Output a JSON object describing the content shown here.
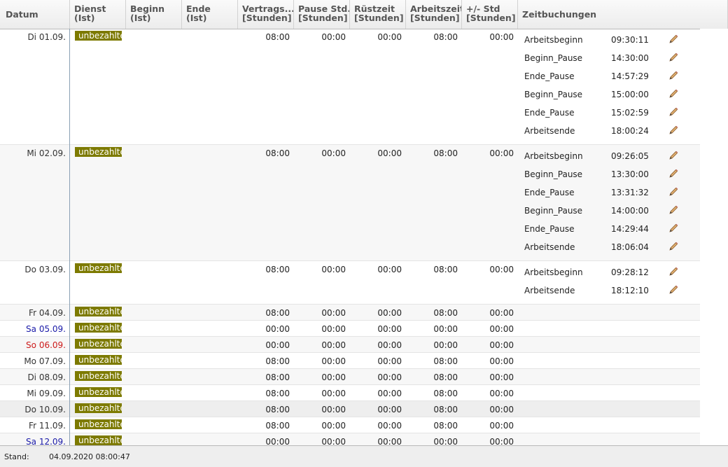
{
  "columns": [
    {
      "l1": "Datum",
      "l2": ""
    },
    {
      "l1": "Dienst",
      "l2": "(Ist)"
    },
    {
      "l1": "Beginn",
      "l2": "(Ist)"
    },
    {
      "l1": "Ende",
      "l2": "(Ist)"
    },
    {
      "l1": "Vertrags...",
      "l2": "[Stunden]"
    },
    {
      "l1": "Pause Std.",
      "l2": "[Stunden]"
    },
    {
      "l1": "Rüstzeit",
      "l2": "[Stunden]"
    },
    {
      "l1": "Arbeitszeit",
      "l2": "[Stunden]"
    },
    {
      "l1": "+/- Std",
      "l2": "[Stunden]"
    },
    {
      "l1": "Zeitbuchungen",
      "l2": ""
    }
  ],
  "rows": [
    {
      "date": "Di 01.09.",
      "day": "weekday",
      "service": "unbezahlte",
      "vertrag": "08:00",
      "pause": "00:00",
      "ruest": "00:00",
      "arbeit": "08:00",
      "diff": "00:00",
      "bookings": [
        {
          "label": "Arbeitsbeginn",
          "time": "09:30:11"
        },
        {
          "label": "Beginn_Pause",
          "time": "14:30:00"
        },
        {
          "label": "Ende_Pause",
          "time": "14:57:29"
        },
        {
          "label": "Beginn_Pause",
          "time": "15:00:00"
        },
        {
          "label": "Ende_Pause",
          "time": "15:02:59"
        },
        {
          "label": "Arbeitsende",
          "time": "18:00:24"
        }
      ]
    },
    {
      "date": "Mi 02.09.",
      "day": "weekday",
      "service": "unbezahlte",
      "vertrag": "08:00",
      "pause": "00:00",
      "ruest": "00:00",
      "arbeit": "08:00",
      "diff": "00:00",
      "bookings": [
        {
          "label": "Arbeitsbeginn",
          "time": "09:26:05"
        },
        {
          "label": "Beginn_Pause",
          "time": "13:30:00"
        },
        {
          "label": "Ende_Pause",
          "time": "13:31:32"
        },
        {
          "label": "Beginn_Pause",
          "time": "14:00:00"
        },
        {
          "label": "Ende_Pause",
          "time": "14:29:44"
        },
        {
          "label": "Arbeitsende",
          "time": "18:06:04"
        }
      ]
    },
    {
      "date": "Do 03.09.",
      "day": "weekday",
      "service": "unbezahlte",
      "vertrag": "08:00",
      "pause": "00:00",
      "ruest": "00:00",
      "arbeit": "08:00",
      "diff": "00:00",
      "bookings": [
        {
          "label": "Arbeitsbeginn",
          "time": "09:28:12"
        },
        {
          "label": "Arbeitsende",
          "time": "18:12:10"
        }
      ]
    },
    {
      "date": "Fr 04.09.",
      "day": "weekday",
      "service": "unbezahlte",
      "vertrag": "08:00",
      "pause": "00:00",
      "ruest": "00:00",
      "arbeit": "08:00",
      "diff": "00:00",
      "bookings": []
    },
    {
      "date": "Sa 05.09.",
      "day": "saturday",
      "service": "unbezahlte",
      "vertrag": "00:00",
      "pause": "00:00",
      "ruest": "00:00",
      "arbeit": "00:00",
      "diff": "00:00",
      "bookings": []
    },
    {
      "date": "So 06.09.",
      "day": "sunday",
      "service": "unbezahlte",
      "vertrag": "00:00",
      "pause": "00:00",
      "ruest": "00:00",
      "arbeit": "00:00",
      "diff": "00:00",
      "bookings": []
    },
    {
      "date": "Mo 07.09.",
      "day": "weekday",
      "service": "unbezahlte",
      "vertrag": "08:00",
      "pause": "00:00",
      "ruest": "00:00",
      "arbeit": "08:00",
      "diff": "00:00",
      "bookings": []
    },
    {
      "date": "Di 08.09.",
      "day": "weekday",
      "service": "unbezahlte",
      "vertrag": "08:00",
      "pause": "00:00",
      "ruest": "00:00",
      "arbeit": "08:00",
      "diff": "00:00",
      "bookings": []
    },
    {
      "date": "Mi 09.09.",
      "day": "weekday",
      "service": "unbezahlte",
      "vertrag": "08:00",
      "pause": "00:00",
      "ruest": "00:00",
      "arbeit": "08:00",
      "diff": "00:00",
      "bookings": []
    },
    {
      "date": "Do 10.09.",
      "day": "weekday",
      "service": "unbezahlte",
      "vertrag": "08:00",
      "pause": "00:00",
      "ruest": "00:00",
      "arbeit": "08:00",
      "diff": "00:00",
      "bookings": [],
      "selected": true
    },
    {
      "date": "Fr 11.09.",
      "day": "weekday",
      "service": "unbezahlte",
      "vertrag": "08:00",
      "pause": "00:00",
      "ruest": "00:00",
      "arbeit": "08:00",
      "diff": "00:00",
      "bookings": []
    },
    {
      "date": "Sa 12.09.",
      "day": "saturday",
      "service": "unbezahlte",
      "vertrag": "00:00",
      "pause": "00:00",
      "ruest": "00:00",
      "arbeit": "00:00",
      "diff": "00:00",
      "bookings": []
    }
  ],
  "footer": {
    "label": "Stand:",
    "value": "04.09.2020 08:00:47"
  },
  "icons": {
    "edit": "pencil-icon"
  },
  "colors": {
    "service_badge": "#7d7a00",
    "saturday": "#1a1aa8",
    "sunday": "#cc1b1b"
  }
}
